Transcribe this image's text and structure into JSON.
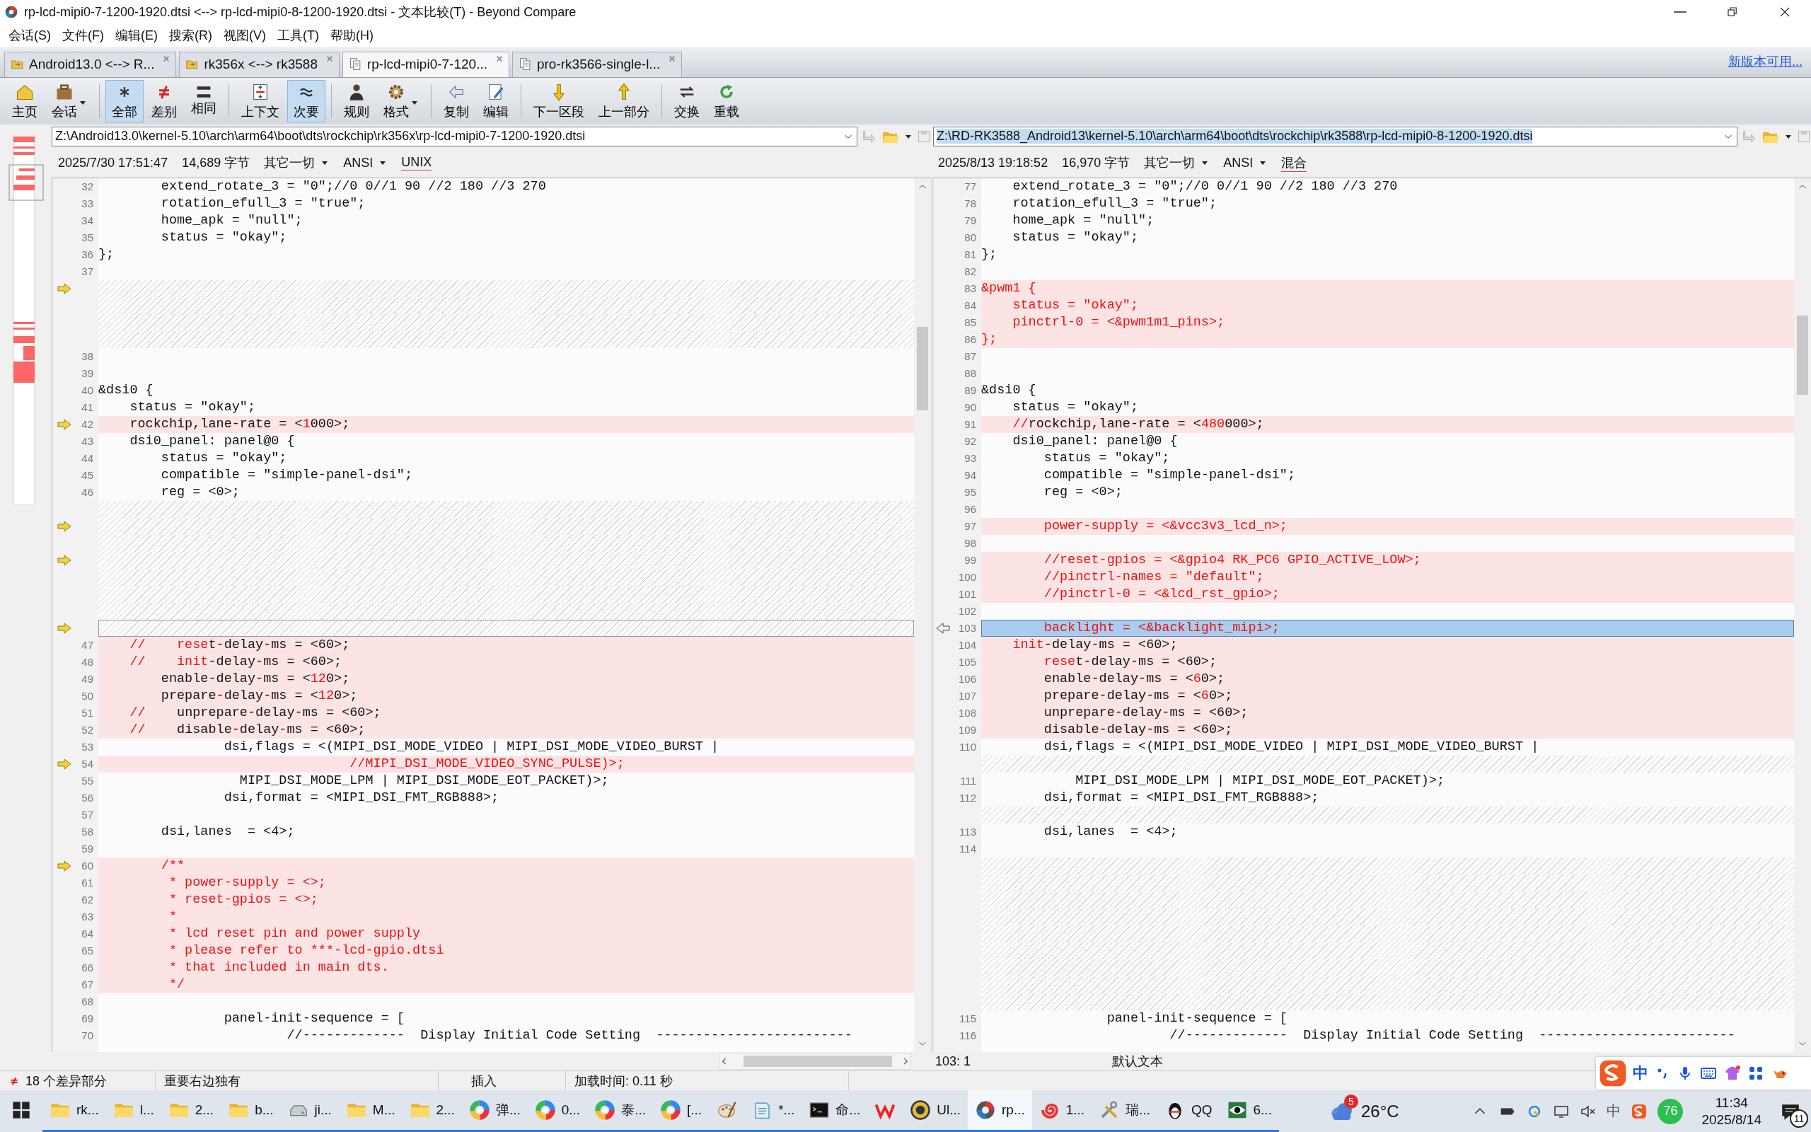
{
  "window": {
    "title": "rp-lcd-mipi0-7-1200-1920.dtsi <--> rp-lcd-mipi0-8-1200-1920.dtsi - 文本比较(T) - Beyond Compare"
  },
  "menu": [
    "会话(S)",
    "文件(F)",
    "编辑(E)",
    "搜索(R)",
    "视图(V)",
    "工具(T)",
    "帮助(H)"
  ],
  "tabs": [
    {
      "label": "Android13.0 <--> R...",
      "kind": "folder",
      "selected": false
    },
    {
      "label": "rk356x <--> rk3588",
      "kind": "folder",
      "selected": false
    },
    {
      "label": "rp-lcd-mipi0-7-120...",
      "kind": "text",
      "selected": true
    },
    {
      "label": "pro-rk3566-single-l...",
      "kind": "text",
      "selected": false
    }
  ],
  "update_link": "新版本可用...",
  "toolbar_groups": [
    {
      "buttons": [
        {
          "label": "主页",
          "selected": false,
          "dropdown": false
        },
        {
          "label": "会话",
          "selected": false,
          "dropdown": true
        }
      ]
    },
    {
      "buttons": [
        {
          "label": "全部",
          "selected": true,
          "dropdown": false
        },
        {
          "label": "差别",
          "selected": false,
          "dropdown": false
        },
        {
          "label": "相同",
          "selected": false,
          "dropdown": false
        }
      ]
    },
    {
      "buttons": [
        {
          "label": "上下文",
          "selected": false,
          "dropdown": false
        },
        {
          "label": "次要",
          "selected": true,
          "dropdown": false
        }
      ]
    },
    {
      "buttons": [
        {
          "label": "规则",
          "selected": false,
          "dropdown": false
        },
        {
          "label": "格式",
          "selected": false,
          "dropdown": true
        }
      ]
    },
    {
      "buttons": [
        {
          "label": "复制",
          "selected": false,
          "dropdown": false
        },
        {
          "label": "编辑",
          "selected": false,
          "dropdown": false
        }
      ]
    },
    {
      "buttons": [
        {
          "label": "下一区段",
          "selected": false,
          "dropdown": false
        },
        {
          "label": "上一部分",
          "selected": false,
          "dropdown": false
        }
      ]
    },
    {
      "buttons": [
        {
          "label": "交换",
          "selected": false,
          "dropdown": false
        },
        {
          "label": "重载",
          "selected": false,
          "dropdown": false
        }
      ]
    }
  ],
  "panes": [
    {
      "path": "Z:\\Android13.0\\kernel-5.10\\arch\\arm64\\boot\\dts\\rockchip\\rk356x\\rp-lcd-mipi0-7-1200-1920.dtsi",
      "selected": false,
      "date": "2025/7/30 17:51:47",
      "size": "14,689 字节",
      "filter": "其它一切",
      "encoding": "ANSI",
      "line_ending": "UNIX",
      "rows": [
        {
          "number": "32",
          "kind": "same",
          "marked": false,
          "parts": [
            {
              "text": "        extend_rotate_3 = \"0\";//0 0//1 90 //2 180 //3 270",
              "changed": false
            }
          ]
        },
        {
          "number": "33",
          "kind": "same",
          "marked": false,
          "parts": [
            {
              "text": "        rotation_efull_3 = \"true\";",
              "changed": false
            }
          ]
        },
        {
          "number": "34",
          "kind": "same",
          "marked": false,
          "parts": [
            {
              "text": "        home_apk = \"null\";",
              "changed": false
            }
          ]
        },
        {
          "number": "35",
          "kind": "same",
          "marked": false,
          "parts": [
            {
              "text": "        status = \"okay\";",
              "changed": false
            }
          ]
        },
        {
          "number": "36",
          "kind": "same",
          "marked": false,
          "parts": [
            {
              "text": "};",
              "changed": false
            }
          ]
        },
        {
          "number": "37",
          "kind": "same",
          "marked": false
        },
        {
          "kind": "gap",
          "marked": true
        },
        {
          "kind": "gap",
          "marked": false
        },
        {
          "kind": "gap",
          "marked": false
        },
        {
          "kind": "gap",
          "marked": false
        },
        {
          "number": "38",
          "kind": "same",
          "marked": false
        },
        {
          "number": "39",
          "kind": "same",
          "marked": false
        },
        {
          "number": "40",
          "kind": "same",
          "marked": false,
          "parts": [
            {
              "text": "&dsi0 {",
              "changed": false
            }
          ]
        },
        {
          "number": "41",
          "kind": "same",
          "marked": false,
          "parts": [
            {
              "text": "    status = \"okay\";",
              "changed": false
            }
          ]
        },
        {
          "number": "42",
          "kind": "diff",
          "marked": true,
          "parts": [
            {
              "text": "    rockchip,lane-rate = <",
              "changed": false
            },
            {
              "text": "1",
              "changed": true
            },
            {
              "text": "000>;",
              "changed": false
            }
          ]
        },
        {
          "number": "43",
          "kind": "same",
          "marked": false,
          "parts": [
            {
              "text": "    dsi0_panel: panel@0 {",
              "changed": false
            }
          ]
        },
        {
          "number": "44",
          "kind": "same",
          "marked": false,
          "parts": [
            {
              "text": "        status = \"okay\";",
              "changed": false
            }
          ]
        },
        {
          "number": "45",
          "kind": "same",
          "marked": false,
          "parts": [
            {
              "text": "        compatible = \"simple-panel-dsi\";",
              "changed": false
            }
          ]
        },
        {
          "number": "46",
          "kind": "same",
          "marked": false,
          "parts": [
            {
              "text": "        reg = <0>;",
              "changed": false
            }
          ]
        },
        {
          "kind": "gap",
          "marked": false
        },
        {
          "kind": "gap",
          "marked": true
        },
        {
          "kind": "gap",
          "marked": false
        },
        {
          "kind": "gap",
          "marked": true
        },
        {
          "kind": "gap",
          "marked": false
        },
        {
          "kind": "gap",
          "marked": false
        },
        {
          "kind": "gap",
          "marked": false
        },
        {
          "kind": "current-gap",
          "marked": true
        },
        {
          "number": "47",
          "kind": "diff",
          "marked": false,
          "parts": [
            {
              "text": "    //    rese",
              "changed": true
            },
            {
              "text": "t-delay-ms = <60>;",
              "changed": false
            }
          ]
        },
        {
          "number": "48",
          "kind": "diff",
          "marked": false,
          "parts": [
            {
              "text": "    //    init",
              "changed": true
            },
            {
              "text": "-delay-ms = <60>;",
              "changed": false
            }
          ]
        },
        {
          "number": "49",
          "kind": "diff",
          "marked": false,
          "parts": [
            {
              "text": "        enable-delay-ms = <",
              "changed": false
            },
            {
              "text": "12",
              "changed": true
            },
            {
              "text": "0>;",
              "changed": false
            }
          ]
        },
        {
          "number": "50",
          "kind": "diff",
          "marked": false,
          "parts": [
            {
              "text": "        prepare-delay-ms = <",
              "changed": false
            },
            {
              "text": "12",
              "changed": true
            },
            {
              "text": "0>;",
              "changed": false
            }
          ]
        },
        {
          "number": "51",
          "kind": "diff",
          "marked": false,
          "parts": [
            {
              "text": "    //",
              "changed": true
            },
            {
              "text": "    unprepare-delay-ms = <60>;",
              "changed": false
            }
          ]
        },
        {
          "number": "52",
          "kind": "diff",
          "marked": false,
          "parts": [
            {
              "text": "    //",
              "changed": true
            },
            {
              "text": "    disable-delay-ms = <60>;",
              "changed": false
            }
          ]
        },
        {
          "number": "53",
          "kind": "same",
          "marked": false,
          "parts": [
            {
              "text": "                dsi,flags = <(MIPI_DSI_MODE_VIDEO | MIPI_DSI_MODE_VIDEO_BURST |",
              "changed": false
            }
          ]
        },
        {
          "number": "54",
          "kind": "diff",
          "marked": true,
          "parts": [
            {
              "text": "                                //MIPI_DSI_MODE_VIDEO_SYNC_PULSE)>;",
              "changed": true
            }
          ]
        },
        {
          "number": "55",
          "kind": "same",
          "marked": false,
          "parts": [
            {
              "text": "                  MIPI_DSI_MODE_LPM | MIPI_DSI_MODE_EOT_PACKET)>;",
              "changed": false
            }
          ]
        },
        {
          "number": "56",
          "kind": "same",
          "marked": false,
          "parts": [
            {
              "text": "                dsi,format = <MIPI_DSI_FMT_RGB888>;",
              "changed": false
            }
          ]
        },
        {
          "number": "57",
          "kind": "same",
          "marked": false
        },
        {
          "number": "58",
          "kind": "same",
          "marked": false,
          "parts": [
            {
              "text": "        dsi,lanes  = <4>;",
              "changed": false
            }
          ]
        },
        {
          "number": "59",
          "kind": "same",
          "marked": false
        },
        {
          "number": "60",
          "kind": "diff",
          "marked": true,
          "parts": [
            {
              "text": "        /**",
              "changed": true
            }
          ]
        },
        {
          "number": "61",
          "kind": "diff",
          "marked": false,
          "parts": [
            {
              "text": "         * power-supply = <>;",
              "changed": true
            }
          ]
        },
        {
          "number": "62",
          "kind": "diff",
          "marked": false,
          "parts": [
            {
              "text": "         * reset-gpios = <>;",
              "changed": true
            }
          ]
        },
        {
          "number": "63",
          "kind": "diff",
          "marked": false,
          "parts": [
            {
              "text": "         *",
              "changed": true
            }
          ]
        },
        {
          "number": "64",
          "kind": "diff",
          "marked": false,
          "parts": [
            {
              "text": "         * lcd reset pin and power supply",
              "changed": true
            }
          ]
        },
        {
          "number": "65",
          "kind": "diff",
          "marked": false,
          "parts": [
            {
              "text": "         * please refer to ***-lcd-gpio.dtsi",
              "changed": true
            }
          ]
        },
        {
          "number": "66",
          "kind": "diff",
          "marked": false,
          "parts": [
            {
              "text": "         * that included in main dts.",
              "changed": true
            }
          ]
        },
        {
          "number": "67",
          "kind": "diff",
          "marked": false,
          "parts": [
            {
              "text": "         */",
              "changed": true
            }
          ]
        },
        {
          "number": "68",
          "kind": "same",
          "marked": false
        },
        {
          "number": "69",
          "kind": "same",
          "marked": false,
          "parts": [
            {
              "text": "                panel-init-sequence = [",
              "changed": false
            }
          ]
        },
        {
          "number": "70",
          "kind": "same",
          "marked": false,
          "parts": [
            {
              "text": "                        //-------------  Display Initial Code Setting  -------------------------",
              "changed": false
            }
          ]
        }
      ]
    },
    {
      "path": "Z:\\RD-RK3588_Android13\\kernel-5.10\\arch\\arm64\\boot\\dts\\rockchip\\rk3588\\rp-lcd-mipi0-8-1200-1920.dtsi",
      "selected": true,
      "date": "2025/8/13 19:18:52",
      "size": "16,970 字节",
      "filter": "其它一切",
      "encoding": "ANSI",
      "line_ending": "混合",
      "cursor": "103: 1",
      "format": "默认文本",
      "rows": [
        {
          "number": "77",
          "kind": "same",
          "marked": false,
          "parts": [
            {
              "text": "    extend_rotate_3 = \"0\";//0 0//1 90 //2 180 //3 270",
              "changed": false
            }
          ]
        },
        {
          "number": "78",
          "kind": "same",
          "marked": false,
          "parts": [
            {
              "text": "    rotation_efull_3 = \"true\";",
              "changed": false
            }
          ]
        },
        {
          "number": "79",
          "kind": "same",
          "marked": false,
          "parts": [
            {
              "text": "    home_apk = \"null\";",
              "changed": false
            }
          ]
        },
        {
          "number": "80",
          "kind": "same",
          "marked": false,
          "parts": [
            {
              "text": "    status = \"okay\";",
              "changed": false
            }
          ]
        },
        {
          "number": "81",
          "kind": "same",
          "marked": false,
          "parts": [
            {
              "text": "};",
              "changed": false
            }
          ]
        },
        {
          "number": "82",
          "kind": "same",
          "marked": false
        },
        {
          "number": "83",
          "kind": "diff",
          "marked": false,
          "parts": [
            {
              "text": "&pwm1 {",
              "changed": true
            }
          ]
        },
        {
          "number": "84",
          "kind": "diff",
          "marked": false,
          "parts": [
            {
              "text": "    status = \"okay\";",
              "changed": true
            }
          ]
        },
        {
          "number": "85",
          "kind": "diff",
          "marked": false,
          "parts": [
            {
              "text": "    pinctrl-0 = <&pwm1m1_pins>;",
              "changed": true
            }
          ]
        },
        {
          "number": "86",
          "kind": "diff",
          "marked": false,
          "parts": [
            {
              "text": "};",
              "changed": true
            }
          ]
        },
        {
          "number": "87",
          "kind": "same",
          "marked": false
        },
        {
          "number": "88",
          "kind": "same",
          "marked": false
        },
        {
          "number": "89",
          "kind": "same",
          "marked": false,
          "parts": [
            {
              "text": "&dsi0 {",
              "changed": false
            }
          ]
        },
        {
          "number": "90",
          "kind": "same",
          "marked": false,
          "parts": [
            {
              "text": "    status = \"okay\";",
              "changed": false
            }
          ]
        },
        {
          "number": "91",
          "kind": "diff",
          "marked": false,
          "parts": [
            {
              "text": "    //",
              "changed": true
            },
            {
              "text": "rockchip,lane-rate = <",
              "changed": false
            },
            {
              "text": "480",
              "changed": true
            },
            {
              "text": "000>;",
              "changed": false
            }
          ]
        },
        {
          "number": "92",
          "kind": "same",
          "marked": false,
          "parts": [
            {
              "text": "    dsi0_panel: panel@0 {",
              "changed": false
            }
          ]
        },
        {
          "number": "93",
          "kind": "same",
          "marked": false,
          "parts": [
            {
              "text": "        status = \"okay\";",
              "changed": false
            }
          ]
        },
        {
          "number": "94",
          "kind": "same",
          "marked": false,
          "parts": [
            {
              "text": "        compatible = \"simple-panel-dsi\";",
              "changed": false
            }
          ]
        },
        {
          "number": "95",
          "kind": "same",
          "marked": false,
          "parts": [
            {
              "text": "        reg = <0>;",
              "changed": false
            }
          ]
        },
        {
          "number": "96",
          "kind": "same",
          "marked": false
        },
        {
          "number": "97",
          "kind": "diff",
          "marked": false,
          "parts": [
            {
              "text": "        power-supply = <&vcc3v3_lcd_n>;",
              "changed": true
            }
          ]
        },
        {
          "number": "98",
          "kind": "same",
          "marked": false
        },
        {
          "number": "99",
          "kind": "diff",
          "marked": false,
          "parts": [
            {
              "text": "        //reset-gpios = <&gpio4 RK_PC6 GPIO_ACTIVE_LOW>;",
              "changed": true
            }
          ]
        },
        {
          "number": "100",
          "kind": "diff",
          "marked": false,
          "parts": [
            {
              "text": "        //pinctrl-names = \"default\";",
              "changed": true
            }
          ]
        },
        {
          "number": "101",
          "kind": "diff",
          "marked": false,
          "parts": [
            {
              "text": "        //pinctrl-0 = <&lcd_rst_gpio>;",
              "changed": true
            }
          ]
        },
        {
          "number": "102",
          "kind": "same",
          "marked": false
        },
        {
          "number": "103",
          "kind": "current",
          "marked": true,
          "parts": [
            {
              "text": "        backlight = <&backlight_mipi>;",
              "changed": true
            }
          ]
        },
        {
          "number": "104",
          "kind": "diff",
          "marked": false,
          "parts": [
            {
              "text": "    init",
              "changed": true
            },
            {
              "text": "-delay-ms = <60>;",
              "changed": false
            }
          ]
        },
        {
          "number": "105",
          "kind": "diff",
          "marked": false,
          "parts": [
            {
              "text": "        rese",
              "changed": true
            },
            {
              "text": "t-delay-ms = <60>;",
              "changed": false
            }
          ]
        },
        {
          "number": "106",
          "kind": "diff",
          "marked": false,
          "parts": [
            {
              "text": "        enable-delay-ms = <",
              "changed": false
            },
            {
              "text": "6",
              "changed": true
            },
            {
              "text": "0>;",
              "changed": false
            }
          ]
        },
        {
          "number": "107",
          "kind": "diff",
          "marked": false,
          "parts": [
            {
              "text": "        prepare-delay-ms = <",
              "changed": false
            },
            {
              "text": "6",
              "changed": true
            },
            {
              "text": "0>;",
              "changed": false
            }
          ]
        },
        {
          "number": "108",
          "kind": "diff",
          "marked": false,
          "parts": [
            {
              "text": "        unprepare-delay-ms = <60>;",
              "changed": false
            }
          ]
        },
        {
          "number": "109",
          "kind": "diff",
          "marked": false,
          "parts": [
            {
              "text": "        disable-delay-ms = <60>;",
              "changed": false
            }
          ]
        },
        {
          "number": "110",
          "kind": "same",
          "marked": false,
          "parts": [
            {
              "text": "        dsi,flags = <(MIPI_DSI_MODE_VIDEO | MIPI_DSI_MODE_VIDEO_BURST |",
              "changed": false
            }
          ]
        },
        {
          "kind": "gap",
          "marked": false
        },
        {
          "number": "111",
          "kind": "same",
          "marked": false,
          "parts": [
            {
              "text": "            MIPI_DSI_MODE_LPM | MIPI_DSI_MODE_EOT_PACKET)>;",
              "changed": false
            }
          ]
        },
        {
          "number": "112",
          "kind": "same",
          "marked": false,
          "parts": [
            {
              "text": "        dsi,format = <MIPI_DSI_FMT_RGB888>;",
              "changed": false
            }
          ]
        },
        {
          "kind": "gap",
          "marked": false
        },
        {
          "number": "113",
          "kind": "same",
          "marked": false,
          "parts": [
            {
              "text": "        dsi,lanes  = <4>;",
              "changed": false
            }
          ]
        },
        {
          "number": "114",
          "kind": "same",
          "marked": false
        },
        {
          "kind": "gap",
          "marked": false
        },
        {
          "kind": "gap",
          "marked": false
        },
        {
          "kind": "gap",
          "marked": false
        },
        {
          "kind": "gap",
          "marked": false
        },
        {
          "kind": "gap",
          "marked": false
        },
        {
          "kind": "gap",
          "marked": false
        },
        {
          "kind": "gap",
          "marked": false
        },
        {
          "kind": "gap",
          "marked": false
        },
        {
          "kind": "gap",
          "marked": false
        },
        {
          "number": "115",
          "kind": "same",
          "marked": false,
          "parts": [
            {
              "text": "                panel-init-sequence = [",
              "changed": false
            }
          ]
        },
        {
          "number": "116",
          "kind": "same",
          "marked": false,
          "parts": [
            {
              "text": "                        //-------------  Display Initial Code Setting  -------------------------",
              "changed": false
            }
          ]
        }
      ]
    }
  ],
  "status_bar": {
    "differences": "18 个差异部分",
    "filter": "重要右边独有",
    "mode": "插入",
    "load_time": "加载时间: 0.11 秒"
  },
  "ime_bar": {
    "mode": "中"
  },
  "taskbar": {
    "items": [
      {
        "kind": "folder",
        "label": "rk...",
        "selected": false
      },
      {
        "kind": "folder",
        "label": "l...",
        "selected": false
      },
      {
        "kind": "folder",
        "label": "2...",
        "selected": false
      },
      {
        "kind": "folder",
        "label": "b...",
        "selected": false
      },
      {
        "kind": "drive",
        "label": "ji...",
        "selected": false
      },
      {
        "kind": "folder",
        "label": "M...",
        "selected": false
      },
      {
        "kind": "folder",
        "label": "2...",
        "selected": false
      },
      {
        "kind": "wheel",
        "label": "弹...",
        "selected": false
      },
      {
        "kind": "wheel",
        "label": "0...",
        "selected": false
      },
      {
        "kind": "wheel",
        "label": "泰...",
        "selected": false
      },
      {
        "kind": "wheel",
        "label": "[...",
        "selected": false
      },
      {
        "kind": "paint",
        "selected": false
      },
      {
        "kind": "notepad",
        "label": "*...",
        "selected": false
      },
      {
        "kind": "terminal",
        "label": "命...",
        "selected": false
      },
      {
        "kind": "wps",
        "selected": false
      },
      {
        "kind": "ue",
        "label": "Ul...",
        "selected": false
      },
      {
        "kind": "bc",
        "label": "rp...",
        "selected": true
      },
      {
        "kind": "swirl",
        "label": "1...",
        "selected": false
      },
      {
        "kind": "tools",
        "label": "瑞...",
        "selected": false
      },
      {
        "kind": "qq",
        "label": "QQ",
        "selected": false
      },
      {
        "kind": "eye",
        "label": "6...",
        "selected": false
      }
    ],
    "weather": {
      "badge": "5",
      "temperature": "26°C"
    },
    "tray": {
      "input_mode": "中",
      "score": "76",
      "time": "11:34",
      "date": "2025/8/14",
      "notifications": "11"
    }
  }
}
